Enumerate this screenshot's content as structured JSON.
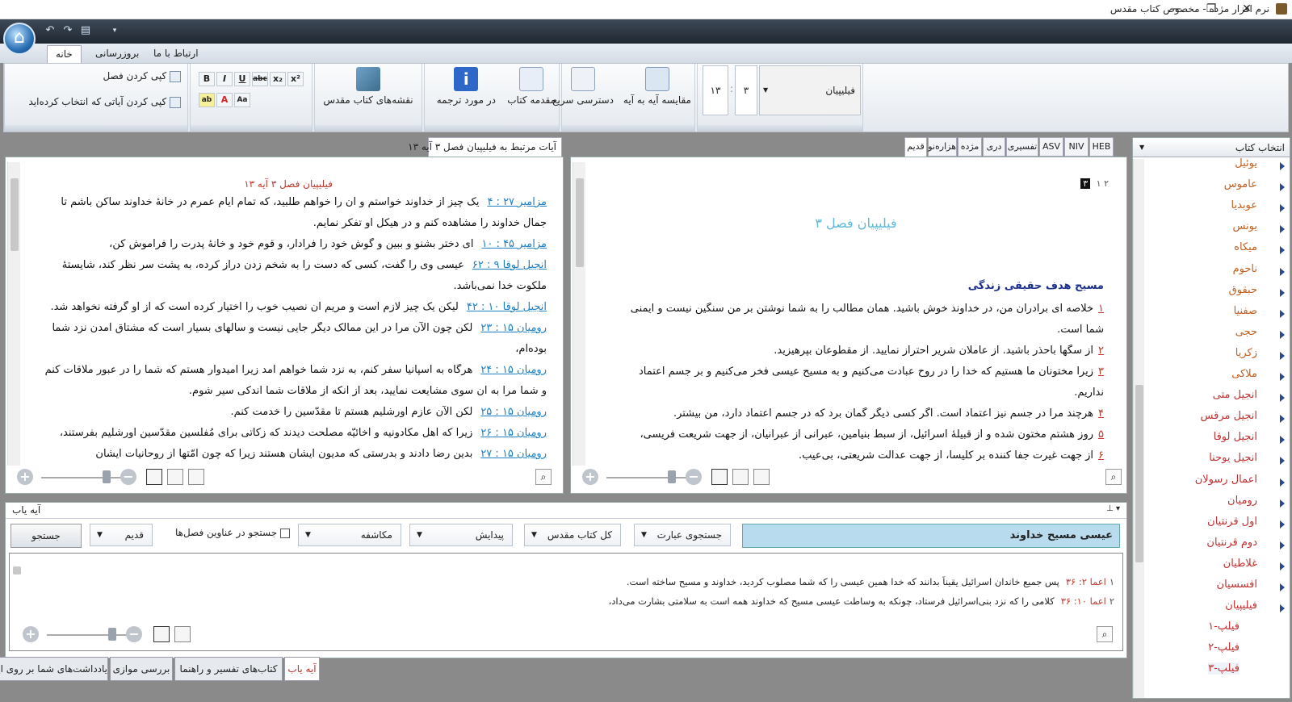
{
  "window": {
    "title": "نرم افزار مژده - مخصوص کتاب مقدس",
    "minimize": "—",
    "restore": "❐",
    "close": "✕"
  },
  "qat": {
    "home_glyph": "⌂"
  },
  "ribbon_tabs": [
    "خانه",
    "بروزرسانی",
    "ارتباط با ما"
  ],
  "ribbon": {
    "copy_chapter": "کپی کردن فصل",
    "copy_selected": "کپی کردن آیاتی که انتخاب کرده‌اید",
    "maps": "نقشه‌های کتاب مقدس",
    "about_translation": "در مورد ترجمه",
    "book_intro": "مقدمه کتاب",
    "quick_access": "دسترسی سریع",
    "compare": "مقایسه آیه به آیه",
    "book_select": "فیلیپیان",
    "chapter": "۳",
    "verse": "۱۳",
    "colon": ":"
  },
  "translation_tabs": [
    "قدیم",
    "هزاره‌نو",
    "مژده",
    "دری",
    "تفسیری",
    "ASV",
    "NIV",
    "HEB"
  ],
  "book_panel": {
    "title": "انتخاب کتاب",
    "books": [
      "یوئیل",
      "عاموس",
      "عوبدیا",
      "یونس",
      "میکاه",
      "ناحوم",
      "حبقوق",
      "صفنیا",
      "حجی",
      "زکریا",
      "ملاکی",
      "انجیل متی",
      "انجیل مرقس",
      "انجیل لوقا",
      "انجیل یوحنا",
      "اعمال رسولان",
      "رومیان",
      "اول قرنتیان",
      "دوم قرنتیان",
      "غلاطیان",
      "افسسیان",
      "فیلیپیان"
    ],
    "subitems": [
      "فیلپ-۱",
      "فیلپ-۲",
      "فیلپ-۳"
    ]
  },
  "main_text": {
    "chapter_nav": "۲  ۱",
    "chapter_current": "۳",
    "chapter_title": "فیلیپیان فصل ۳",
    "section_heading": "مسیح هدف حقیقی زندگی",
    "verses": [
      {
        "n": "۱",
        "t": "خلاصه ای برادران من، در خداوند خوش باشید. همان مطالب را به شما نوشتن بر من سنگین نیست و ایمنی"
      },
      {
        "n": "",
        "t": "شما است."
      },
      {
        "n": "۲",
        "t": "از سگها باحذر باشید. از عاملان شریر احتراز نمایید. از مقطوعان بپرهیزید."
      },
      {
        "n": "۳",
        "t": "زیرا مختونان ما هستیم که خدا را در روح عبادت می‌کنیم و به مسیح عیسی فخر می‌کنیم و بر جسم اعتماد"
      },
      {
        "n": "",
        "t": "نداریم."
      },
      {
        "n": "۴",
        "t": "هرچند مرا در جسم نیز اعتماد است. اگر کسی دیگر گمان برد که در جسم اعتماد دارد، من بیشتر."
      },
      {
        "n": "۵",
        "t": "روز هشتم مختون شده و از قبیلهٔ اسرائیل، از سبط بنیامین، عبرانی از عبرانیان، از جهت شریعت فریسی،"
      },
      {
        "n": "۶",
        "t": "از جهت غیرت جفا کننده بر کلیسا، از جهت عدالت شریعتی، بی‌عیب."
      }
    ]
  },
  "related": {
    "tab": "آیات مرتبط به فیلیپیان فصل ۳ آیه ۱۳",
    "title": "فیلیپیان فصل ۳ آیه ۱۳",
    "lines": [
      {
        "ref": "مزامیر ۲۷ : ۴",
        "t": "یک چیز از خداوند خواستم و آن را خواهم طلبید، که تمام ایام عمرم در خانهٔ خداوند ساکن باشم تا"
      },
      {
        "ref": "",
        "t": "جمال خداوند را مشاهده کنم و در هیکل او تفکر نمایم."
      },
      {
        "ref": "مزامیر ۴۵ : ۱۰",
        "t": "ای دختر بشنو و ببین و گوش خود را فرادار، و قوم خود و خانهٔ پدرت را فراموش کن،"
      },
      {
        "ref": "انجیل لوقا ۹ : ۶۲",
        "t": "عیسی وی را گفت، کسی که دست را به شخم زدن دراز کرده، به پشت سر نظر کند، شایستهٔ"
      },
      {
        "ref": "",
        "t": "ملکوت خدا نمی‌باشد."
      },
      {
        "ref": "انجیل لوقا ۱۰ : ۴۲",
        "t": "لیکن یک چیز لازم است و مریم آن نصیب خوب را اختیار کرده است که از او گرفته نخواهد شد."
      },
      {
        "ref": "رومیان ۱۵ : ۲۳",
        "t": "لکن چون الآن مرا در این ممالک دیگر جایی نیست و سالهای بسیار است که مشتاق آمدن نزد شما"
      },
      {
        "ref": "",
        "t": "بوده‌ام،"
      },
      {
        "ref": "رومیان ۱۵ : ۲۴",
        "t": "هرگاه به اسپانیا سفر کنم، به نزد شما خواهم آمد زیرا امیدوار هستم که شما را در عبور ملاقات کنم"
      },
      {
        "ref": "",
        "t": "و شما مرا به آن سوی مشایعت نمایید، بعد از آنکه از ملاقات شما اندکی سیر شوم."
      },
      {
        "ref": "رومیان ۱۵ : ۲۵",
        "t": "لکن الآن عازم اورشلیم هستم تا مقدّسین را خدمت کنم."
      },
      {
        "ref": "رومیان ۱۵ : ۲۶",
        "t": "زیرا که اهل مکادونیه و اخائیّه مصلحت دیدند که زکاتی برای مُفلسین مقدّسین اورشلیم بفرستند،"
      },
      {
        "ref": "رومیان ۱۵ : ۲۷",
        "t": "بدین رضا دادند و بدرستی که مدیون ایشان هستند زیرا که چون امّتها از روحانیات ایشان"
      }
    ]
  },
  "search": {
    "panel_title": "آیه یاب",
    "pin": "📌",
    "query": "عیسی مسیح خداوند",
    "mode": "جستجوی عبارت",
    "scope": "کل کتاب مقدس",
    "from_book": "پیدایش",
    "to_book": "مکاشفه",
    "in_titles": "جستجو در عناوین فصل‌ها",
    "translation": "قدیم",
    "search_button": "جستجو",
    "results": [
      {
        "n": "۱",
        "ref": "اعما ۲: ۳۶",
        "t": "پس جمیع خاندان اسرائیل یقیناً بدانند که خدا همین عیسی را که شما مصلوب کردید، خداوند و مسیح ساخته است."
      },
      {
        "n": "۲",
        "ref": "اعما ۱۰: ۳۶",
        "t": "کلامی را که نزد بنی‌اسرائیل فرستاد، چونکه به وساطت عیسی مسیح که خداوند همه است به سلامتی بشارت می‌داد،"
      }
    ]
  },
  "bottom_tabs": [
    "آیه یاب",
    "کتاب‌های تفسیر و راهنما",
    "بررسی موازی",
    "یادداشت‌های شما بر روی این فصل"
  ],
  "colors": {
    "accent": "#1e7fc4",
    "verse_number": "#c0392b",
    "heading": "#1a2f8a",
    "query_bg": "#b8dcee"
  }
}
